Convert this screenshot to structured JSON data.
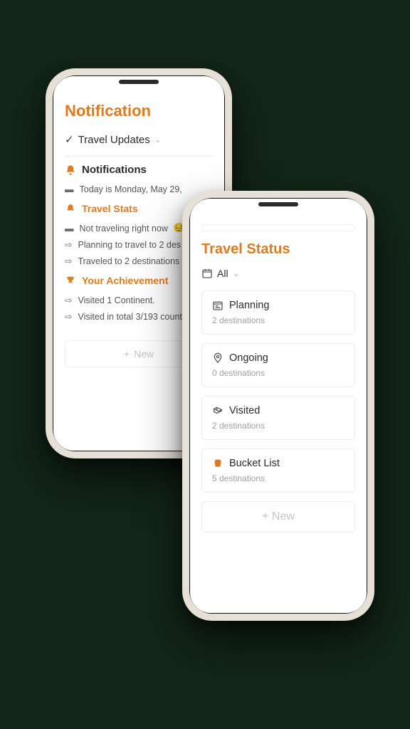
{
  "phone1": {
    "title": "Notification",
    "toggle_label": "Travel Updates",
    "notifications_heading": "Notifications",
    "today_line": "Today is Monday, May 29,",
    "travel_stats_heading": "Travel Stats",
    "stats": {
      "not_traveling": "Not traveling right now",
      "planning": "Planning to travel to 2 des",
      "traveled": "Traveled to 2 destinations"
    },
    "achievement_heading": "Your Achievement",
    "achievements": {
      "continent": "Visited 1 Continent.",
      "countries": "Visited in total 3/193 count"
    },
    "new_label": "New"
  },
  "phone2": {
    "title": "Travel Status",
    "filter_label": "All",
    "cards": [
      {
        "label": "Planning",
        "sub": "2 destinations"
      },
      {
        "label": "Ongoing",
        "sub": "0 destinations"
      },
      {
        "label": "Visited",
        "sub": "2 destinations"
      },
      {
        "label": "Bucket List",
        "sub": "5 destinations"
      }
    ],
    "new_label": "New"
  }
}
